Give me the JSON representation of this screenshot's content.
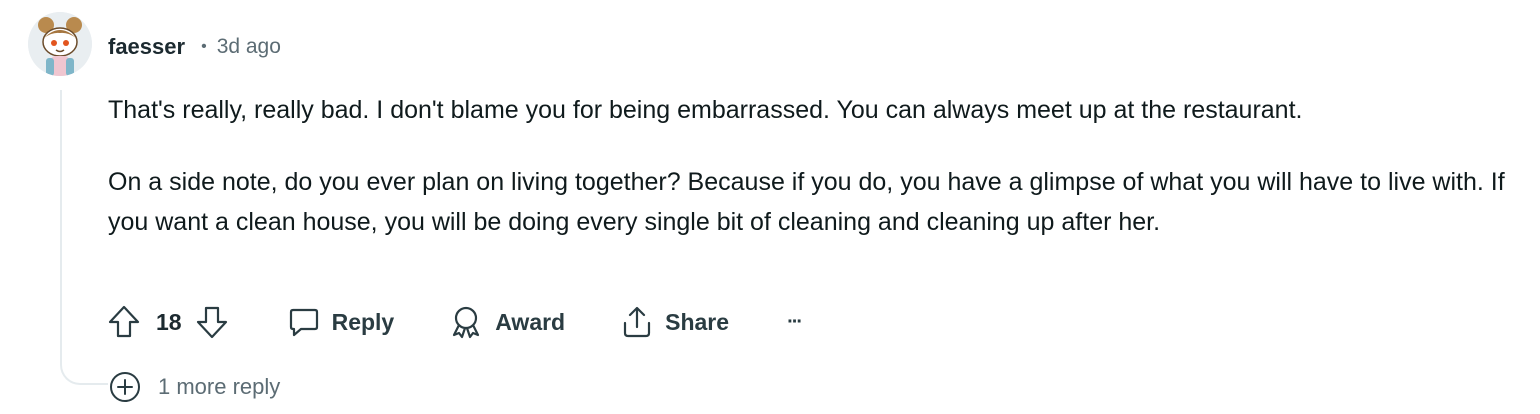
{
  "comment": {
    "username": "faesser",
    "separator": "•",
    "age": "3d ago",
    "paragraphs": [
      "That's really, really bad. I don't blame you for being embarrassed. You can always meet up at the restaurant.",
      "On a side note, do you ever plan on living together? Because if you do, you have a glimpse of what you will have to live with. If you want a clean house, you will be doing every single bit of cleaning and cleaning up after her."
    ]
  },
  "actions": {
    "vote_count": "18",
    "reply_label": "Reply",
    "award_label": "Award",
    "share_label": "Share",
    "more_label": "···"
  },
  "more_replies": {
    "label": "1 more reply"
  },
  "icons": {
    "upvote": "upvote-arrow-icon",
    "downvote": "downvote-arrow-icon",
    "reply": "speech-bubble-icon",
    "award": "award-ribbon-icon",
    "share": "share-upload-icon",
    "expand": "plus-circle-icon"
  },
  "colors": {
    "text": "#0f1a1c",
    "meta": "#5c6c74",
    "thread_line": "#e5ebee"
  }
}
